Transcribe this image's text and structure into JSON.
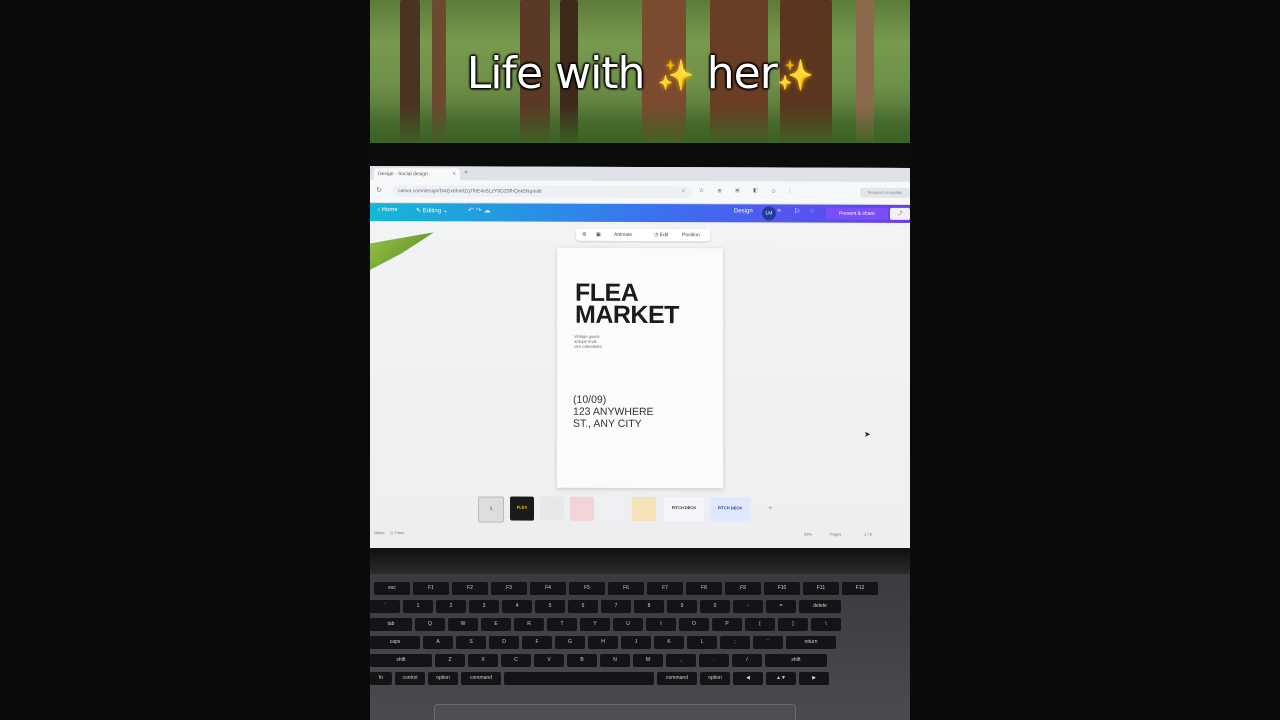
{
  "caption": {
    "text_before": "Life with ",
    "sparkle": "✨",
    "text_middle": " her"
  },
  "browser": {
    "tab_title": "Design - Social design",
    "tab_close": "×",
    "new_tab": "+",
    "url": "canva.com/design/DAGx6hn0Zq7/bE4n5LzY8GZ8fhQnk5Ng/edit",
    "toolbar_icons": "⌕ ☆ ⊞ ▣ ◧ ⊙ ⋮",
    "side_button": "Relaunch to update"
  },
  "canva": {
    "home": "‹ Home",
    "editing": "✎ Editing ⌄",
    "undo_redo": "↶ ↷ ☁",
    "design": "Design",
    "avatar": "LM",
    "plus": "+",
    "share": "Present & share",
    "extra": "⤴"
  },
  "context_toolbar": {
    "items": [
      "⚙",
      "▣",
      "Animate",
      "◷ Edit",
      "Position"
    ]
  },
  "poster": {
    "title": "FLEA\nMARKET",
    "small_text": "Vintage goods\nantique finds\nrare collectibles",
    "details": "(10/09)\n123 ANYWHERE\nST., ANY CITY"
  },
  "thumbnails": [
    {
      "label": "1",
      "color": "#f5f5f5"
    },
    {
      "label": "FLEA",
      "color": "#1b1b1b"
    },
    {
      "label": "",
      "color": "#e8e8e8"
    },
    {
      "label": "",
      "color": "#f2d4d8"
    },
    {
      "label": "",
      "color": "#eef0f4"
    },
    {
      "label": "",
      "color": "#f5e2b8"
    },
    {
      "label": "PITCH DECK",
      "color": "#f4f6f9"
    },
    {
      "label": "PITCH DECK",
      "color": "#dfe8ff"
    }
  ],
  "thumb_add": "+",
  "statusbar": {
    "notes": "Notes",
    "timer": "◷ Timer",
    "zoom": "33%",
    "pages": "Pages",
    "page_count": "1 / 8"
  },
  "keyboard": {
    "row1": [
      "esc",
      "F1",
      "F2",
      "F3",
      "F4",
      "F5",
      "F6",
      "F7",
      "F8",
      "F9",
      "F10",
      "F11",
      "F12"
    ],
    "row2": [
      "`",
      "1",
      "2",
      "3",
      "4",
      "5",
      "6",
      "7",
      "8",
      "9",
      "0",
      "-",
      "=",
      "delete"
    ],
    "row3": [
      "tab",
      "Q",
      "W",
      "E",
      "R",
      "T",
      "Y",
      "U",
      "I",
      "O",
      "P",
      "[",
      "]",
      "\\"
    ],
    "row4": [
      "caps",
      "A",
      "S",
      "D",
      "F",
      "G",
      "H",
      "J",
      "K",
      "L",
      ";",
      "'",
      "return"
    ],
    "row5": [
      "shift",
      "Z",
      "X",
      "C",
      "V",
      "B",
      "N",
      "M",
      ",",
      ".",
      "/",
      "shift"
    ],
    "row6": [
      "fn",
      "control",
      "option",
      "command",
      "",
      "command",
      "option",
      "◀",
      "▲▼",
      "▶"
    ]
  }
}
